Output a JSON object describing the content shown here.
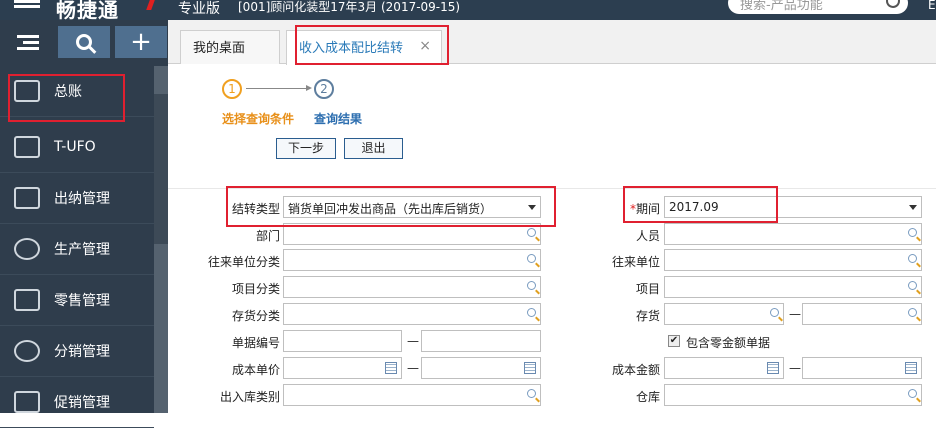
{
  "topbar": {
    "brand": "畅捷通",
    "edition": "专业版",
    "account": "[001]顾问化装型17年3月  (2017-09-15)",
    "search_placeholder": "搜索-产品功能",
    "right_char": "E"
  },
  "sidebar": {
    "items": [
      {
        "label": "总账",
        "icon": "ledger-icon"
      },
      {
        "label": "T-UFO",
        "icon": "tufo-icon"
      },
      {
        "label": "出纳管理",
        "icon": "cashier-doc-icon"
      },
      {
        "label": "生产管理",
        "icon": "gears-icon"
      },
      {
        "label": "零售管理",
        "icon": "shopping-bag-icon"
      },
      {
        "label": "分销管理",
        "icon": "network-icon"
      },
      {
        "label": "促销管理",
        "icon": "megaphone-icon"
      }
    ]
  },
  "tabs": [
    {
      "label": "我的桌面"
    },
    {
      "label": "收入成本配比结转",
      "close": "×"
    }
  ],
  "steps": {
    "s1_num": "1",
    "s1_label": "选择查询条件",
    "s2_num": "2",
    "s2_label": "查询结果"
  },
  "buttons": {
    "next": "下一步",
    "exit": "退出"
  },
  "form": {
    "transfer_type_label": "结转类型",
    "transfer_type_value": "销货单回冲发出商品（先出库后销货）",
    "period_req": "*",
    "period_label": "期间",
    "period_value": "2017.09",
    "dept_label": "部门",
    "person_label": "人员",
    "partner_cat_label": "往来单位分类",
    "partner_label": "往来单位",
    "project_cat_label": "项目分类",
    "project_label": "项目",
    "inventory_cat_label": "存货分类",
    "inventory_label": "存货",
    "doc_no_label": "单据编号",
    "include_zero_label": "包含零金额单据",
    "include_zero_check": "✔",
    "unit_cost_label": "成本单价",
    "cost_amount_label": "成本金额",
    "io_type_label": "出入库类别",
    "warehouse_label": "仓库",
    "range_sep": "—"
  },
  "colors": {
    "highlight": "#e02030",
    "sidebar": "#2f3d4c",
    "accent": "#2a7ab8"
  }
}
